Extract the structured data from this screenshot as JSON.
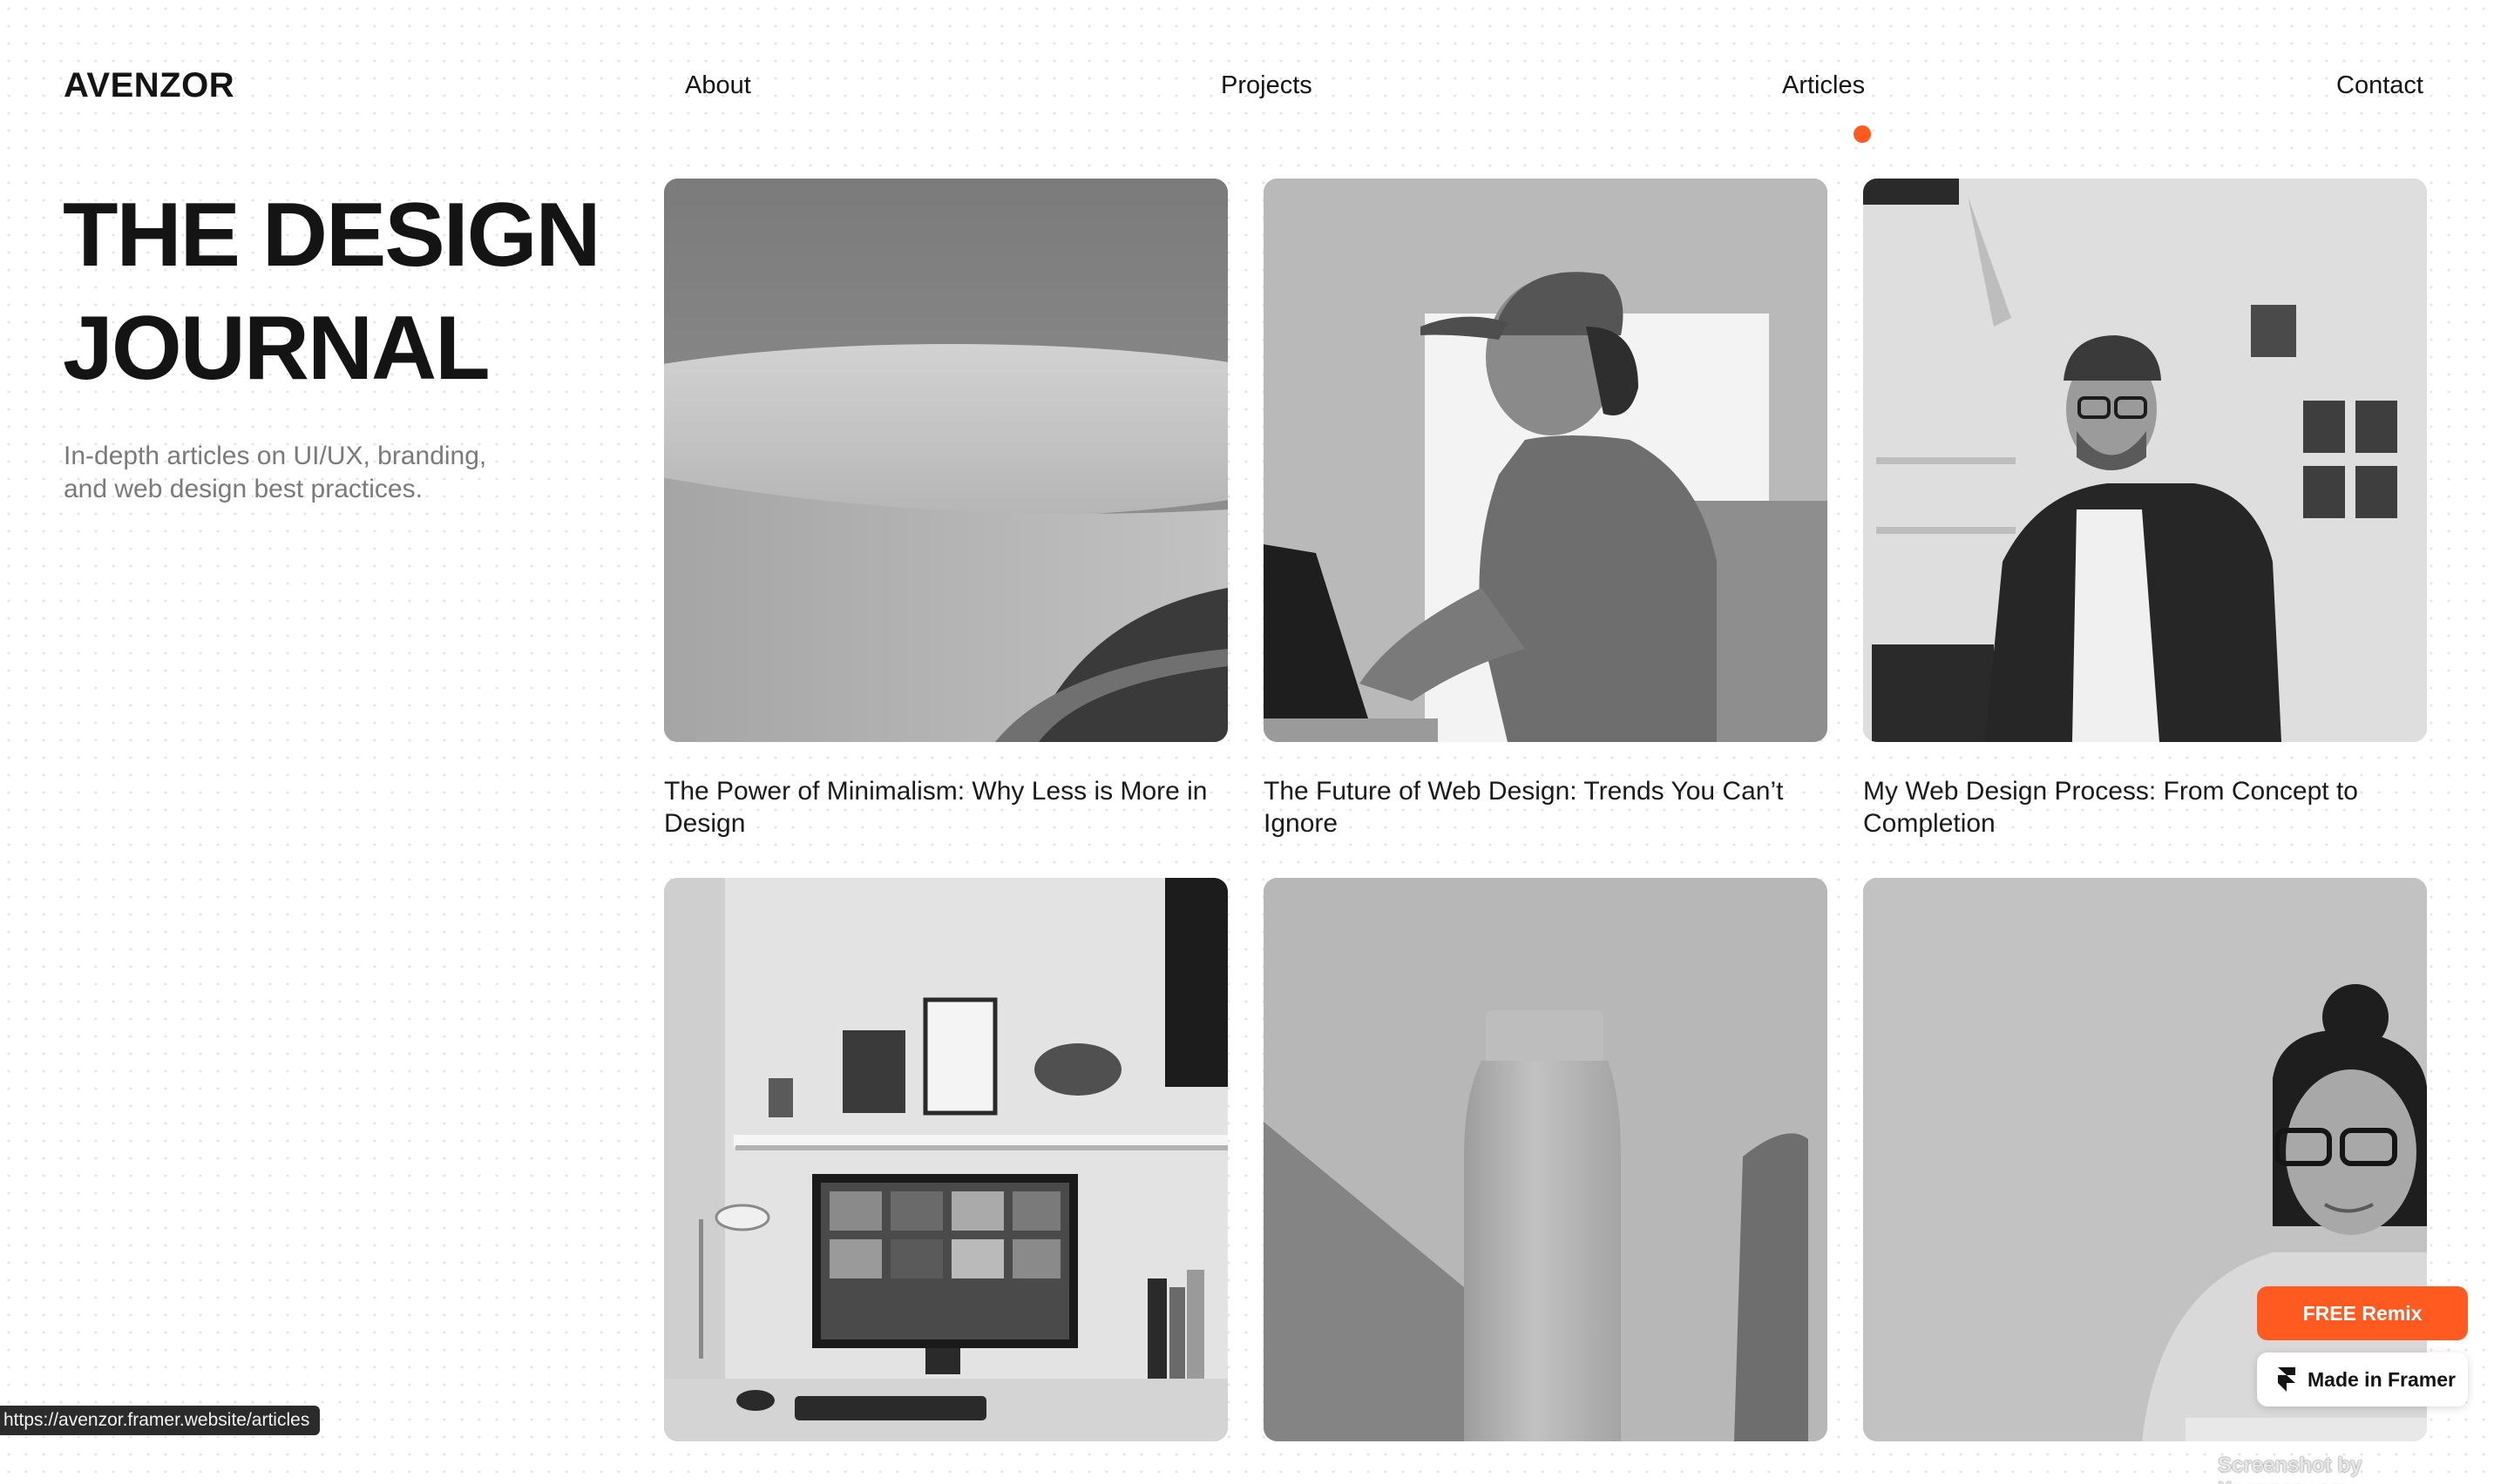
{
  "brand": {
    "logo": "AVENZOR"
  },
  "nav": {
    "items": [
      {
        "label": "About"
      },
      {
        "label": "Projects"
      },
      {
        "label": "Articles"
      },
      {
        "label": "Contact"
      }
    ],
    "active": "Articles",
    "active_dot_color": "#FF5A1F"
  },
  "hero": {
    "title": "THE DESIGN JOURNAL",
    "subtitle": "In-depth articles on UI/UX, branding, and web design best practices."
  },
  "articles": [
    {
      "title": "The Power of Minimalism: Why Less is More in Design",
      "image": "round-table-image"
    },
    {
      "title": "The Future of Web Design: Trends You Can’t Ignore",
      "image": "designer-at-laptop-image"
    },
    {
      "title": "My Web Design Process: From Concept to Completion",
      "image": "man-in-studio-image"
    },
    {
      "title": "",
      "image": "desk-setup-image"
    },
    {
      "title": "",
      "image": "water-bottle-image"
    },
    {
      "title": "",
      "image": "woman-with-glasses-image"
    }
  ],
  "status_bar": {
    "url": "https://avenzor.framer.website/articles"
  },
  "framer": {
    "remix_label": "FREE Remix",
    "made_in_label": "Made in Framer",
    "accent": "#FF5A1F"
  },
  "watermark": "Screenshot by Xnapper.com"
}
